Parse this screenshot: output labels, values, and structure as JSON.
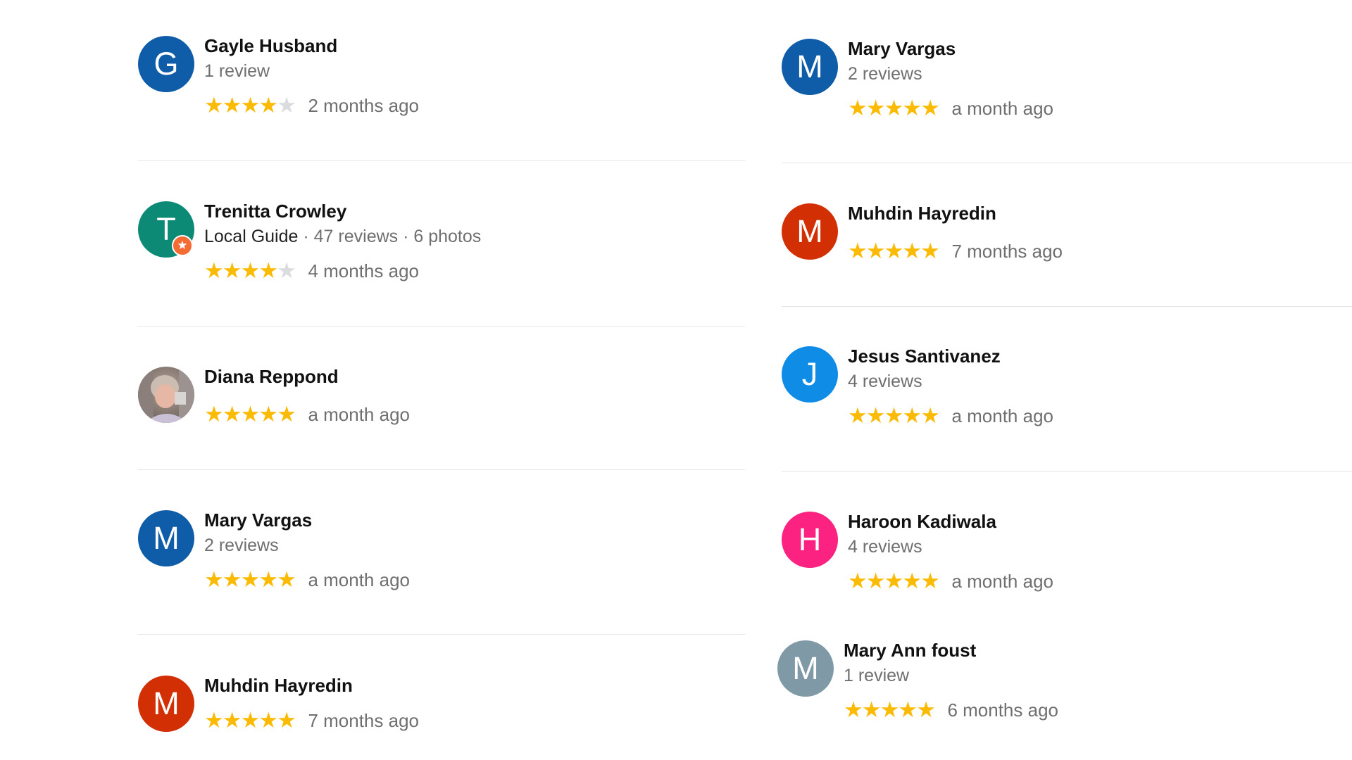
{
  "colors": {
    "star_filled": "#fbbb05",
    "star_empty": "#dadce0",
    "divider": "#e6e6e6",
    "name_text": "#111111",
    "meta_text": "#6f6f6f",
    "local_guide_badge": "#f46b34"
  },
  "left_reviews": [
    {
      "initial": "G",
      "avatar_color": "#0f5ca8",
      "name": "Gayle Husband",
      "meta": "1 review",
      "rating": 4,
      "max_rating": 5,
      "time": "2 months ago"
    },
    {
      "initial": "T",
      "avatar_color": "#0d8a76",
      "local_guide": true,
      "name": "Trenitta Crowley",
      "guide_label": "Local Guide",
      "meta": " · 47 reviews · 6 photos",
      "rating": 4,
      "max_rating": 5,
      "time": "4 months ago"
    },
    {
      "photo_avatar": true,
      "name": "Diana Reppond",
      "rating": 5,
      "max_rating": 5,
      "time": "a month ago"
    },
    {
      "initial": "M",
      "avatar_color": "#0f5ca8",
      "name": "Mary Vargas",
      "meta": "2 reviews",
      "rating": 5,
      "max_rating": 5,
      "time": "a month ago"
    },
    {
      "initial": "M",
      "avatar_color": "#d32f05",
      "name": "Muhdin Hayredin",
      "rating": 5,
      "max_rating": 5,
      "time": "7 months ago"
    }
  ],
  "right_reviews": [
    {
      "initial": "M",
      "avatar_color": "#0f5ca8",
      "name": "Mary Vargas",
      "meta": "2 reviews",
      "rating": 5,
      "max_rating": 5,
      "time": "a month ago"
    },
    {
      "initial": "M",
      "avatar_color": "#d32f05",
      "name": "Muhdin Hayredin",
      "rating": 5,
      "max_rating": 5,
      "time": "7 months ago"
    },
    {
      "initial": "J",
      "avatar_color": "#0f8de6",
      "name": "Jesus Santivanez",
      "meta": "4 reviews",
      "rating": 5,
      "max_rating": 5,
      "time": "a month ago"
    },
    {
      "initial": "H",
      "avatar_color": "#fb2281",
      "name": "Haroon Kadiwala",
      "meta": "4 reviews",
      "rating": 5,
      "max_rating": 5,
      "time": "a month ago"
    },
    {
      "initial": "M",
      "avatar_color": "#7f99a7",
      "name": "Mary Ann foust",
      "meta": "1 review",
      "rating": 5,
      "max_rating": 5,
      "time": "6 months ago"
    }
  ]
}
